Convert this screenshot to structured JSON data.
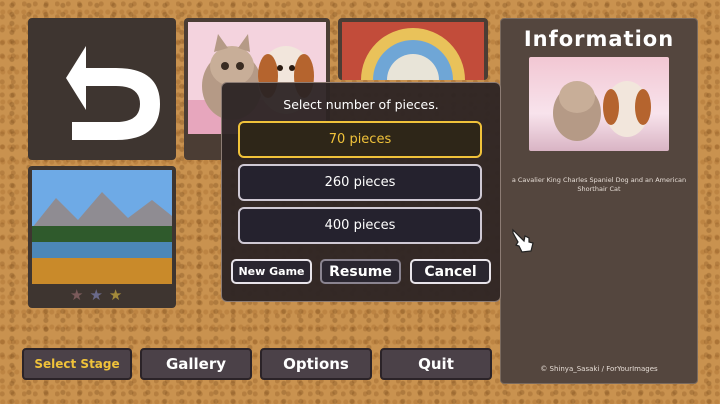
{
  "dialog": {
    "title": "Select number of pieces.",
    "options": [
      {
        "label": "70 pieces",
        "selected": true
      },
      {
        "label": "260 pieces",
        "selected": false
      },
      {
        "label": "400 pieces",
        "selected": false
      }
    ],
    "new_game_label": "New Game",
    "resume_label": "Resume",
    "cancel_label": "Cancel"
  },
  "info": {
    "title": "Information",
    "caption": "a Cavalier King Charles Spaniel Dog and an American Shorthair Cat",
    "credit": "© Shinya_Sasaki / ForYourImages"
  },
  "nav": {
    "select_stage_label": "Select Stage",
    "gallery_label": "Gallery",
    "options_label": "Options",
    "quit_label": "Quit"
  },
  "landscape": {
    "stars": 3
  },
  "colors": {
    "accent": "#f0c23a",
    "panel": "#3e3530",
    "dialog": "#2c2424"
  },
  "icons": [
    "back-arrow-icon",
    "star-icon",
    "pointing-hand-icon"
  ]
}
